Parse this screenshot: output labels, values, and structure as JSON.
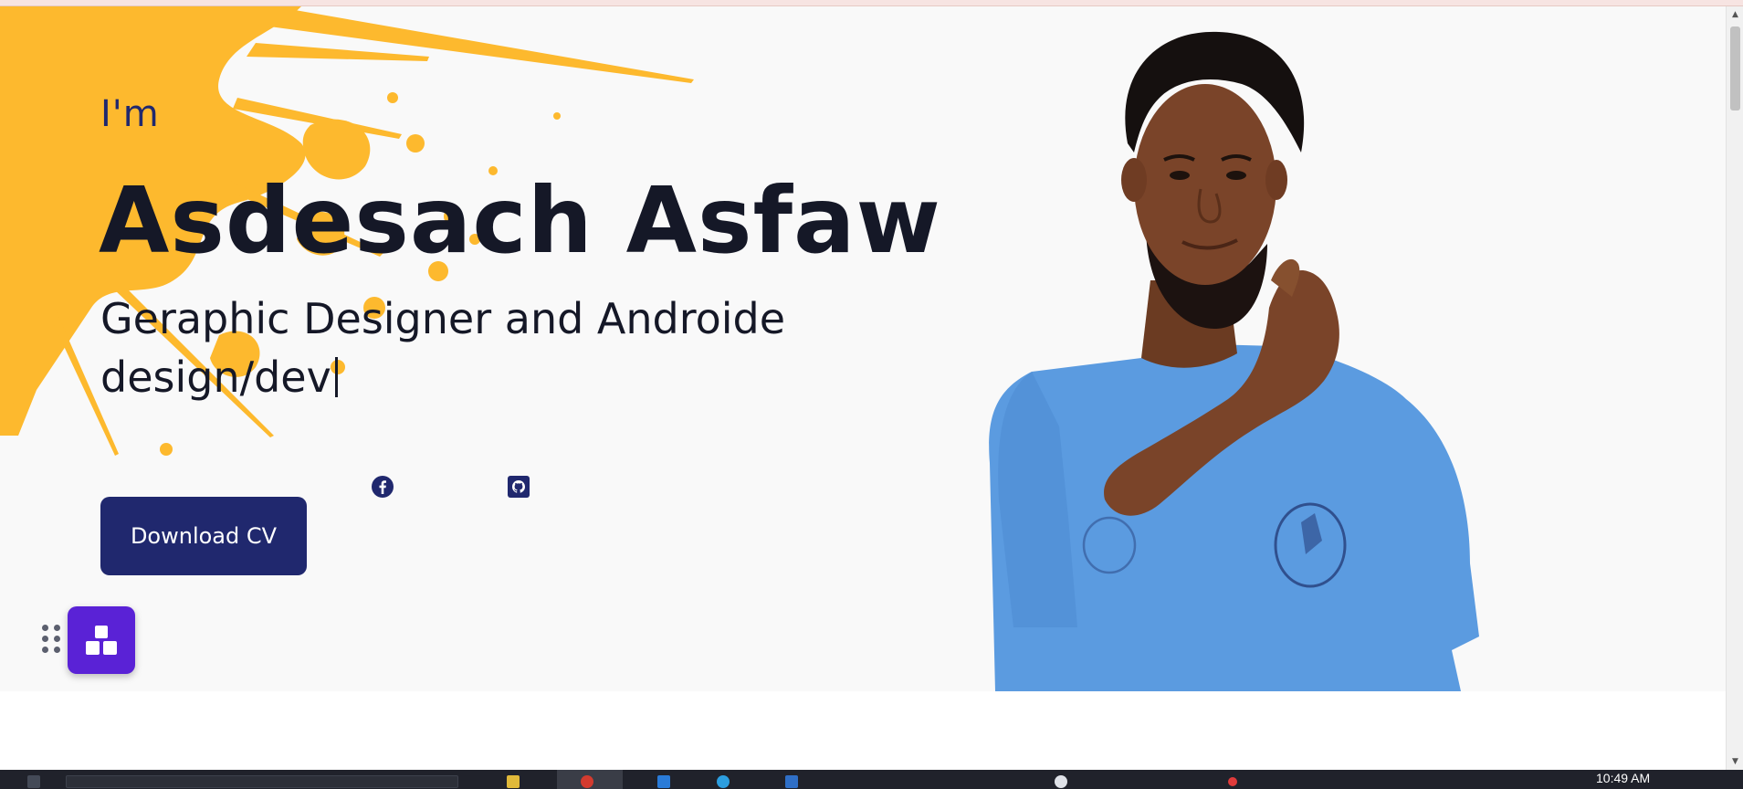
{
  "hero": {
    "greeting": "I'm",
    "name": "Asdesach Asfaw",
    "role_line1": "Geraphic Designer and Androide",
    "role_line2": "design/dev",
    "download_cv_label": "Download CV"
  },
  "social": {
    "facebook_icon": "facebook-icon",
    "github_icon": "github-icon"
  },
  "colors": {
    "accent": "#20286e",
    "splash": "#fdb92e",
    "widget": "#5a22d6",
    "text": "#151827"
  },
  "taskbar": {
    "clock": "10:49 AM"
  }
}
